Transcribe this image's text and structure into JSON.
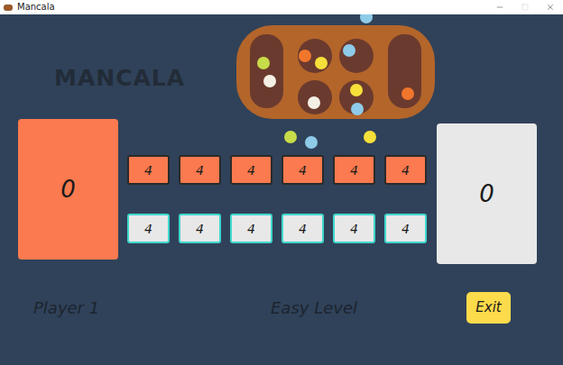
{
  "window": {
    "title": "Mancala"
  },
  "heading": "MANCALA",
  "stores": {
    "left": {
      "score": "0"
    },
    "right": {
      "score": "0"
    }
  },
  "pits": {
    "top": [
      "4",
      "4",
      "4",
      "4",
      "4",
      "4"
    ],
    "bottom": [
      "4",
      "4",
      "4",
      "4",
      "4",
      "4"
    ]
  },
  "footer": {
    "player": "Player 1",
    "level": "Easy Level",
    "exit_button": "Exit"
  }
}
